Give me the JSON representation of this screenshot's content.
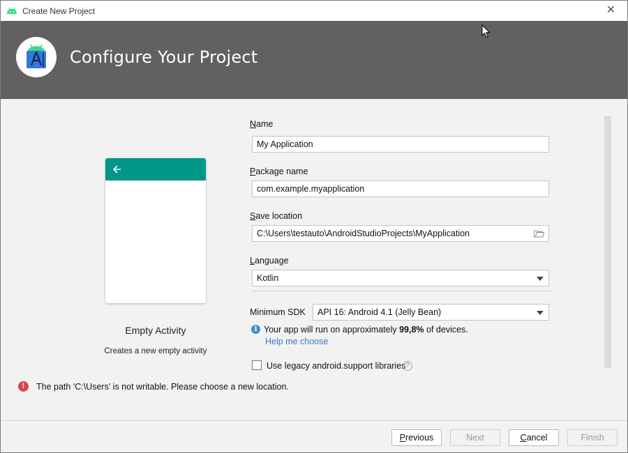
{
  "window": {
    "title": "Create New Project"
  },
  "header": {
    "heading": "Configure Your Project"
  },
  "preview": {
    "activity_title": "Empty Activity",
    "activity_description": "Creates a new empty activity"
  },
  "form": {
    "name": {
      "label_first": "N",
      "label_rest": "ame",
      "value": "My Application"
    },
    "package": {
      "label_first": "P",
      "label_rest": "ackage name",
      "value": "com.example.myapplication"
    },
    "save_location": {
      "label_first": "S",
      "label_rest": "ave location",
      "value": "C:\\Users\\testauto\\AndroidStudioProjects\\MyApplication"
    },
    "language": {
      "label_first": "L",
      "label_rest": "anguage",
      "value": "Kotlin"
    },
    "min_sdk": {
      "label": "Minimum SDK",
      "value": "API 16: Android 4.1 (Jelly Bean)"
    },
    "sdk_info": {
      "prefix": "Your app will run on approximately ",
      "percent": "99,8%",
      "suffix": " of devices."
    },
    "help_link": "Help me choose",
    "legacy_checkbox": {
      "label_pre": "Use le",
      "label_underline": "g",
      "label_post": "acy android.support libraries",
      "checked": false
    }
  },
  "error": {
    "message": "The path 'C:\\Users' is not writable. Please choose a new location."
  },
  "footer": {
    "previous": {
      "first": "P",
      "rest": "revious"
    },
    "next": "Next",
    "cancel": {
      "first": "C",
      "rest": "ancel"
    },
    "finish": "Finish"
  },
  "colors": {
    "header_bg": "#616161",
    "phone_appbar": "#009688",
    "link": "#3a7abf",
    "error": "#d9434b",
    "info": "#3d8fd1"
  },
  "icons": [
    "android-icon",
    "close-icon",
    "android-studio-logo",
    "back-arrow-icon",
    "folder-icon",
    "dropdown-arrow-icon",
    "info-icon",
    "help-icon",
    "error-icon",
    "mouse-cursor"
  ]
}
